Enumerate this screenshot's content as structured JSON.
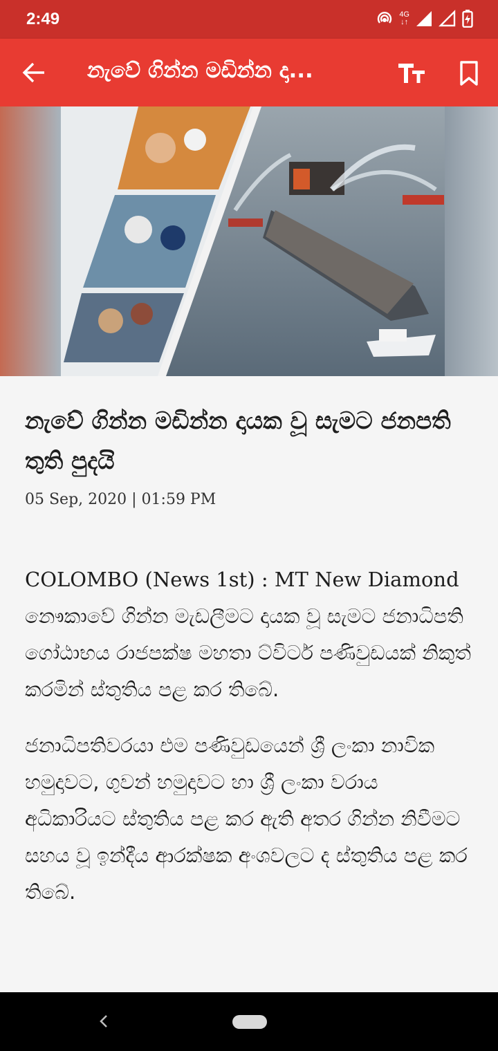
{
  "status_bar": {
    "time": "2:49",
    "network": "4G"
  },
  "app_bar": {
    "title": "නැවේ ගින්න මඩින්න දා...",
    "icons": [
      "back-arrow-icon",
      "text-size-icon",
      "bookmark-icon"
    ]
  },
  "hero_image": {
    "description_icon": "news-photo"
  },
  "article": {
    "headline": "නැවේ ගින්න මඩින්න දායක වූ සැමට ජනපති තුති පුදයි",
    "date": "05 Sep, 2020 | 01:59 PM",
    "paragraph1_en": "COLOMBO (News 1st) : MT New Diamond",
    "paragraph1_si": "නෞකාවේ ගින්න මැඩලීමට දායක වූ සැමට ජනාධිපති ගෝඨාභය රාජපක්ෂ මහතා ට්විටර් පණිවුඩයක් නිකුත් කරමින් ස්තුතිය පළ කර තිබේ.",
    "paragraph2": "ජනාධිපතිවරයා එම පණිවුඩයෙන් ශ්‍රී ලංකා නාවික හමුදාවට, ගුවන් හමුදාවට හා ශ්‍රී ලංකා වරාය අධිකාරියට ස්තුතිය පළ කර ඇති අතර ගින්න නිවීමට සහය වූ ඉන්දීය ආරක්ෂක අංශවලට ද ස්තුතිය පළ කර තිබේ."
  },
  "colors": {
    "status_bar": "#c9302a",
    "app_bar": "#e83b32",
    "background": "#f5f5f5"
  }
}
